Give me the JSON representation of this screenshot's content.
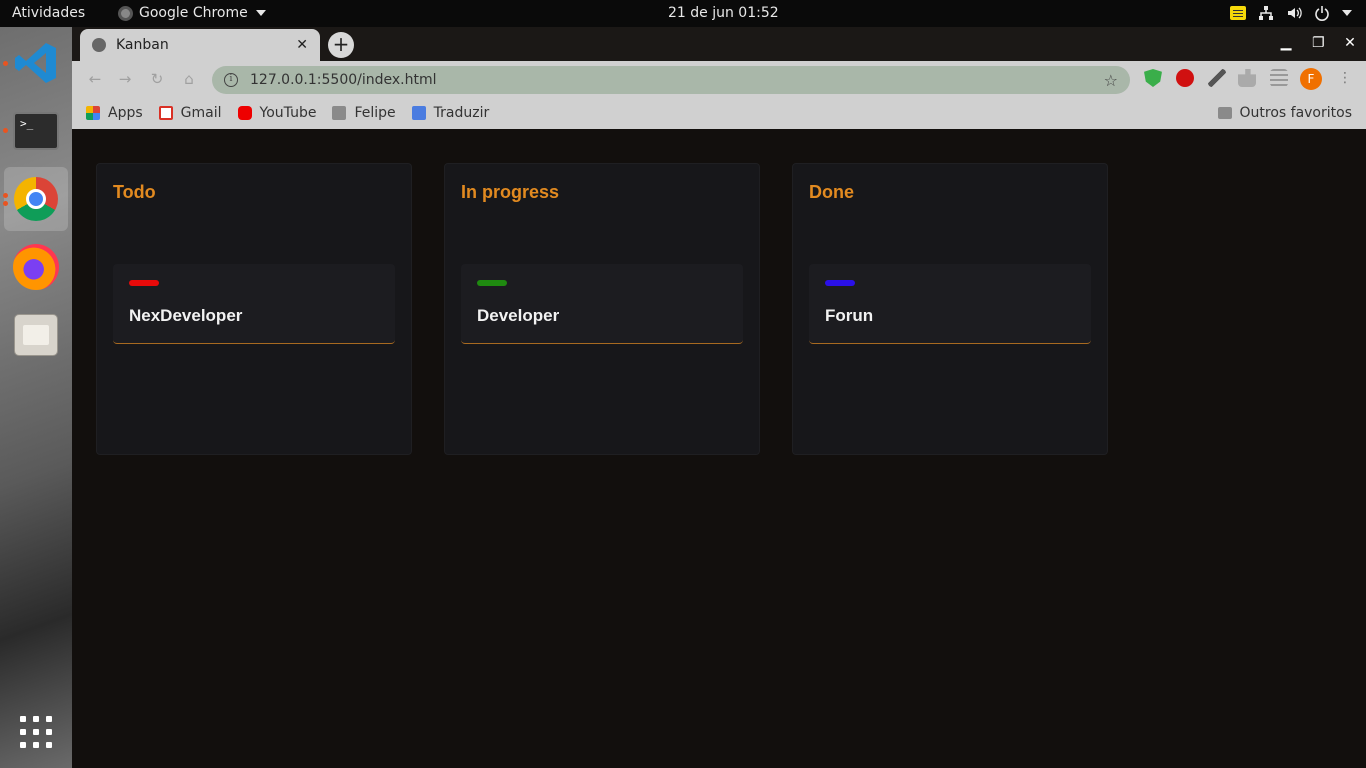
{
  "topbar": {
    "activities": "Atividades",
    "app_name": "Google Chrome",
    "clock": "21 de jun  01:52"
  },
  "browser": {
    "tab_title": "Kanban",
    "url": "127.0.0.1:5500/index.html",
    "avatar_letter": "F",
    "bookmarks": [
      "Apps",
      "Gmail",
      "YouTube",
      "Felipe",
      "Traduzir"
    ],
    "other_bookmarks": "Outros favoritos"
  },
  "board": {
    "columns": [
      {
        "title": "Todo",
        "card": {
          "title": "NexDeveloper",
          "tag_color": "#e80a0a"
        }
      },
      {
        "title": "In progress",
        "card": {
          "title": "Developer",
          "tag_color": "#1f8a10"
        }
      },
      {
        "title": "Done",
        "card": {
          "title": "Forun",
          "tag_color": "#2a10e8"
        }
      }
    ],
    "accent_color": "#e28a20"
  }
}
